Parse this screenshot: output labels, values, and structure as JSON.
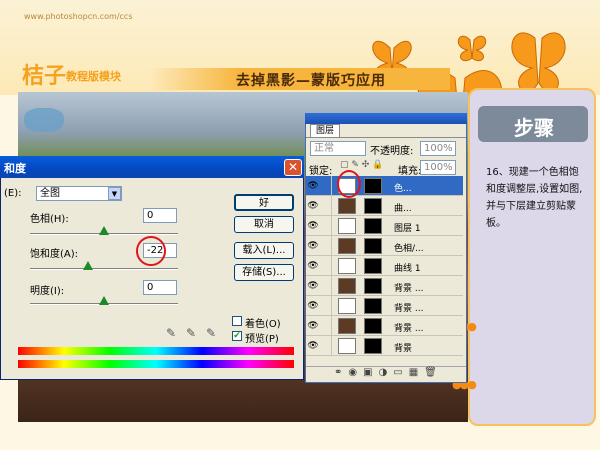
{
  "header": {
    "site_url": "www.photoshopcn.com/ccs",
    "logo": "桔子",
    "logo_sub": "教程版模块",
    "banner_title": "去掉黑影—蒙版巧应用"
  },
  "step": {
    "title": "步骤",
    "text": "16、现建一个色相饱和度调整层,设置如图,并与下层建立剪贴蒙板。"
  },
  "dialog": {
    "title": "和度",
    "edit_label": "(E):",
    "edit_value": "全图",
    "hue_label": "色相(H):",
    "hue_value": "0",
    "hue_level": 0.5,
    "sat_label": "饱和度(A):",
    "sat_value": "-22",
    "sat_level": 0.39,
    "light_label": "明度(I):",
    "light_value": "0",
    "light_level": 0.5,
    "buttons": {
      "ok": "好",
      "cancel": "取消",
      "load": "载入(L)...",
      "save": "存储(S)..."
    },
    "colorize_label": "着色(O)",
    "colorize_checked": false,
    "preview_label": "预览(P)",
    "preview_checked": true,
    "close_glyph": "✕"
  },
  "layers": {
    "tab": "图层",
    "blend_mode": "正常",
    "opacity_label": "不透明度:",
    "opacity_value": "100%",
    "lock_label": "锁定:",
    "fill_label": "填充:",
    "fill_value": "100%",
    "rows": [
      {
        "name": "色...",
        "selected": true
      },
      {
        "name": "曲..."
      },
      {
        "name": "图层 1"
      },
      {
        "name": "色相/..."
      },
      {
        "name": "曲线 1"
      },
      {
        "name": "背景 ..."
      },
      {
        "name": "背景 ..."
      },
      {
        "name": "背景 ..."
      },
      {
        "name": "背景"
      }
    ]
  },
  "colors": {
    "accent": "#f6a21c",
    "annotation": "#e0151b",
    "selection": "#316ac5"
  }
}
